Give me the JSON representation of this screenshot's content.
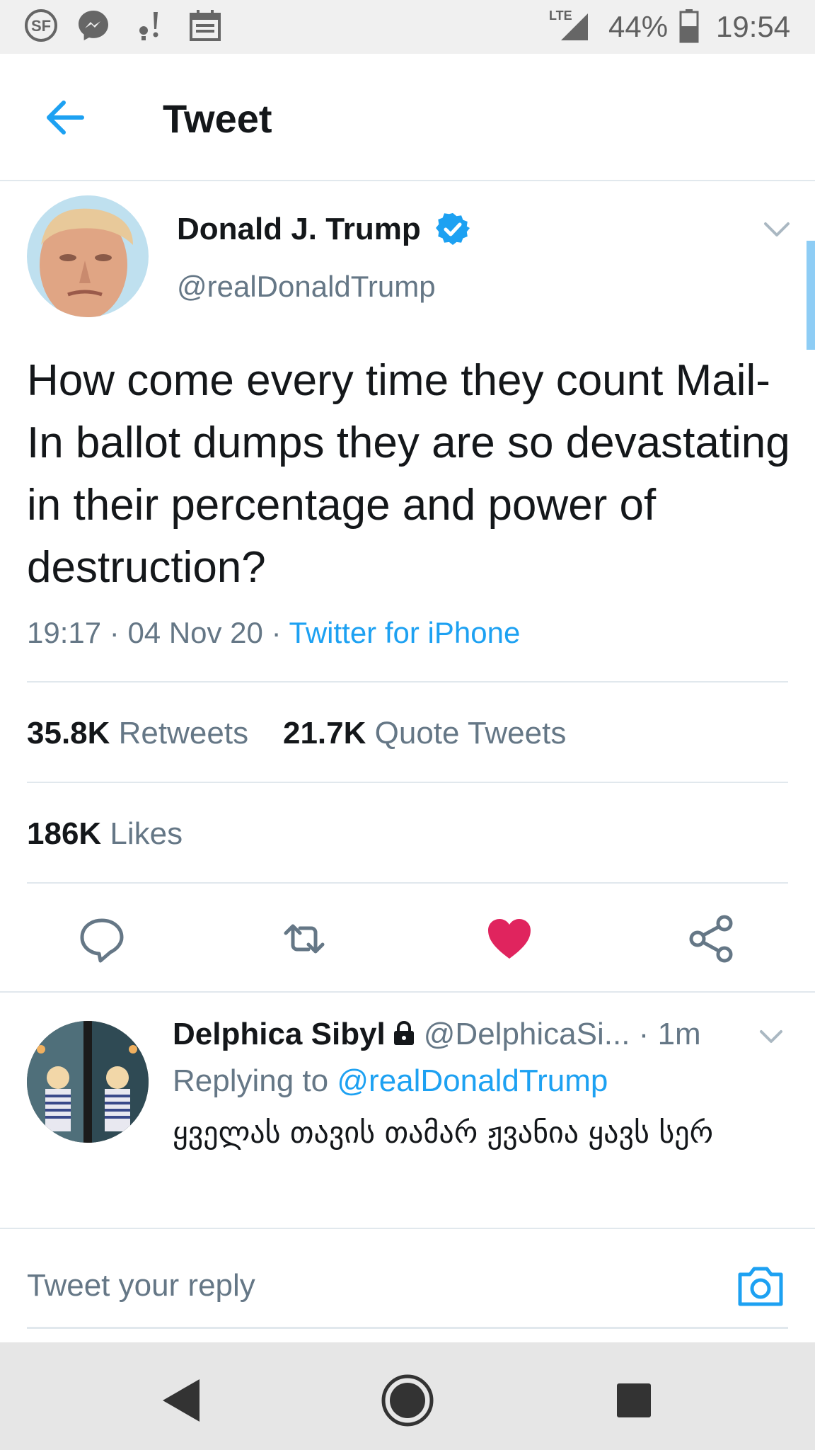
{
  "status_bar": {
    "network": "LTE",
    "battery": "44%",
    "time": "19:54",
    "icons": [
      "sf-logo-icon",
      "messenger-icon",
      "notification-icon",
      "calendar-icon",
      "signal-icon",
      "battery-icon"
    ]
  },
  "header": {
    "title": "Tweet",
    "back_icon": "arrow-left-icon"
  },
  "tweet": {
    "author_name": "Donald J. Trump",
    "handle": "@realDonaldTrump",
    "verified": true,
    "text": "How come every time they count Mail-In ballot dumps they are so devastating in their percentage and power of destruction?",
    "time": "19:17",
    "date": "04 Nov 20",
    "source": "Twitter for iPhone",
    "retweets_count": "35.8K",
    "retweets_label": "Retweets",
    "quotes_count": "21.7K",
    "quotes_label": "Quote Tweets",
    "likes_count": "186K",
    "likes_label": "Likes",
    "liked": true,
    "colors": {
      "accent": "#1da1f2",
      "like": "#e0245e",
      "muted": "#657786"
    }
  },
  "reply": {
    "author_name": "Delphica Sibyl",
    "handle": "@DelphicaSi...",
    "age": "1m",
    "protected": true,
    "replying_label": "Replying to",
    "replying_to": "@realDonaldTrump",
    "text": "ყველას თავის თამარ ჟვანია ყავს სერ"
  },
  "compose": {
    "placeholder": "Tweet your reply",
    "camera_icon": "camera-icon"
  },
  "nav_bar": {
    "icons": [
      "nav-back-icon",
      "nav-home-icon",
      "nav-recents-icon"
    ]
  }
}
